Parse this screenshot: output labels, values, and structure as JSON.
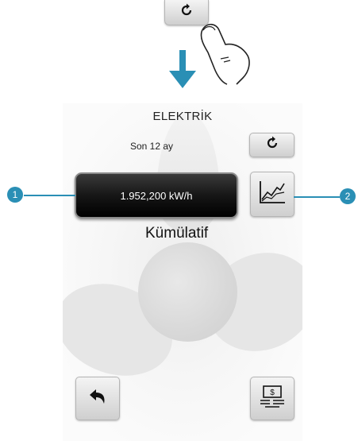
{
  "screen": {
    "title": "ELEKTRİK",
    "period": "Son 12 ay",
    "value": "1.952,200 kW/h",
    "mode": "Kümülatif"
  },
  "callouts": {
    "one": "1",
    "two": "2"
  },
  "colors": {
    "accent": "#2a8fb5",
    "value_box": "#111111"
  },
  "icons": {
    "top_refresh": "refresh-icon",
    "hand": "pointing-hand-icon",
    "arrow": "arrow-down-icon",
    "refresh": "refresh-icon",
    "graph": "line-graph-icon",
    "back": "back-arrow-icon",
    "cost": "money-icon"
  }
}
